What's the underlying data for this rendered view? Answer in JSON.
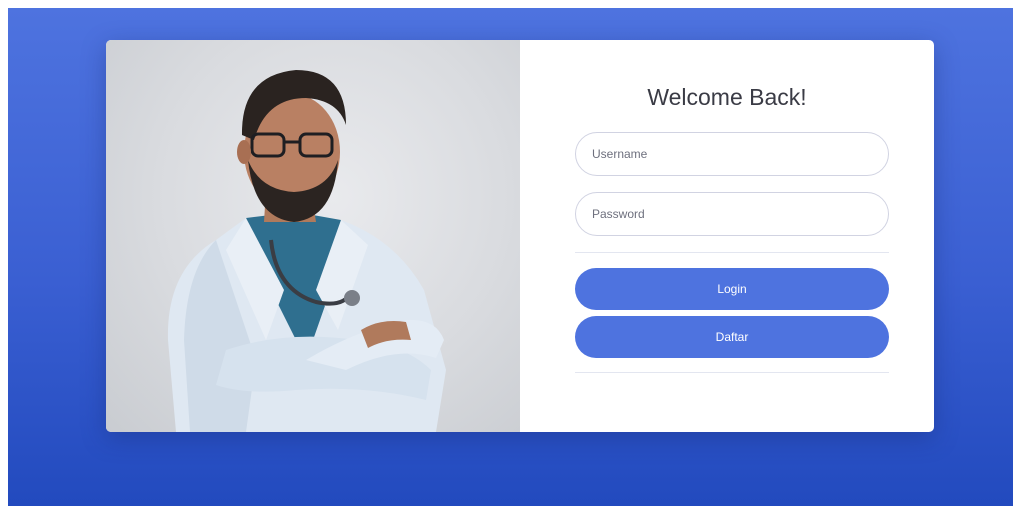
{
  "colors": {
    "background_gradient_top": "#4e73df",
    "background_gradient_bottom": "#224abe",
    "primary_button": "#4e73df",
    "card": "#ffffff"
  },
  "login_card": {
    "image_icon": "doctor-portrait-photo",
    "title": "Welcome Back!",
    "username": {
      "placeholder": "Username",
      "value": ""
    },
    "password": {
      "placeholder": "Password",
      "value": ""
    },
    "login_label": "Login",
    "register_label": "Daftar"
  }
}
